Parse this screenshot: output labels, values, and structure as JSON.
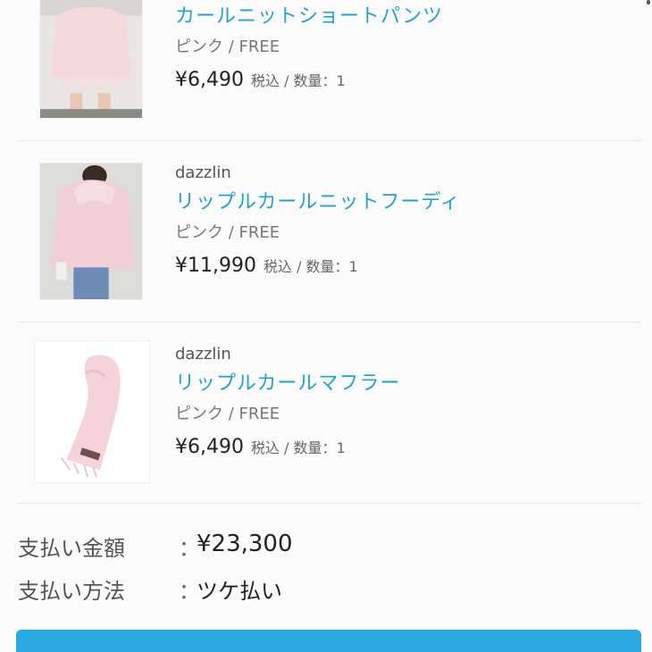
{
  "items": [
    {
      "brand": "",
      "name": "カールニットショートパンツ",
      "variant": "ピンク / FREE",
      "price": "¥6,490",
      "meta": "税込 / 数量：1"
    },
    {
      "brand": "dazzlin",
      "name": "リップルカールニットフーディ",
      "variant": "ピンク / FREE",
      "price": "¥11,990",
      "meta": "税込 / 数量：1"
    },
    {
      "brand": "dazzlin",
      "name": "リップルカールマフラー",
      "variant": "ピンク / FREE",
      "price": "¥6,490",
      "meta": "税込 / 数量：1"
    }
  ],
  "summary": {
    "payment_total_label": "支払い金額",
    "payment_total_value": "¥23,300",
    "payment_method_label": "支払い方法",
    "payment_method_value": "ツケ払い",
    "colon": "："
  },
  "colors": {
    "link": "#2a9fc4",
    "button": "#2aa8e0"
  }
}
